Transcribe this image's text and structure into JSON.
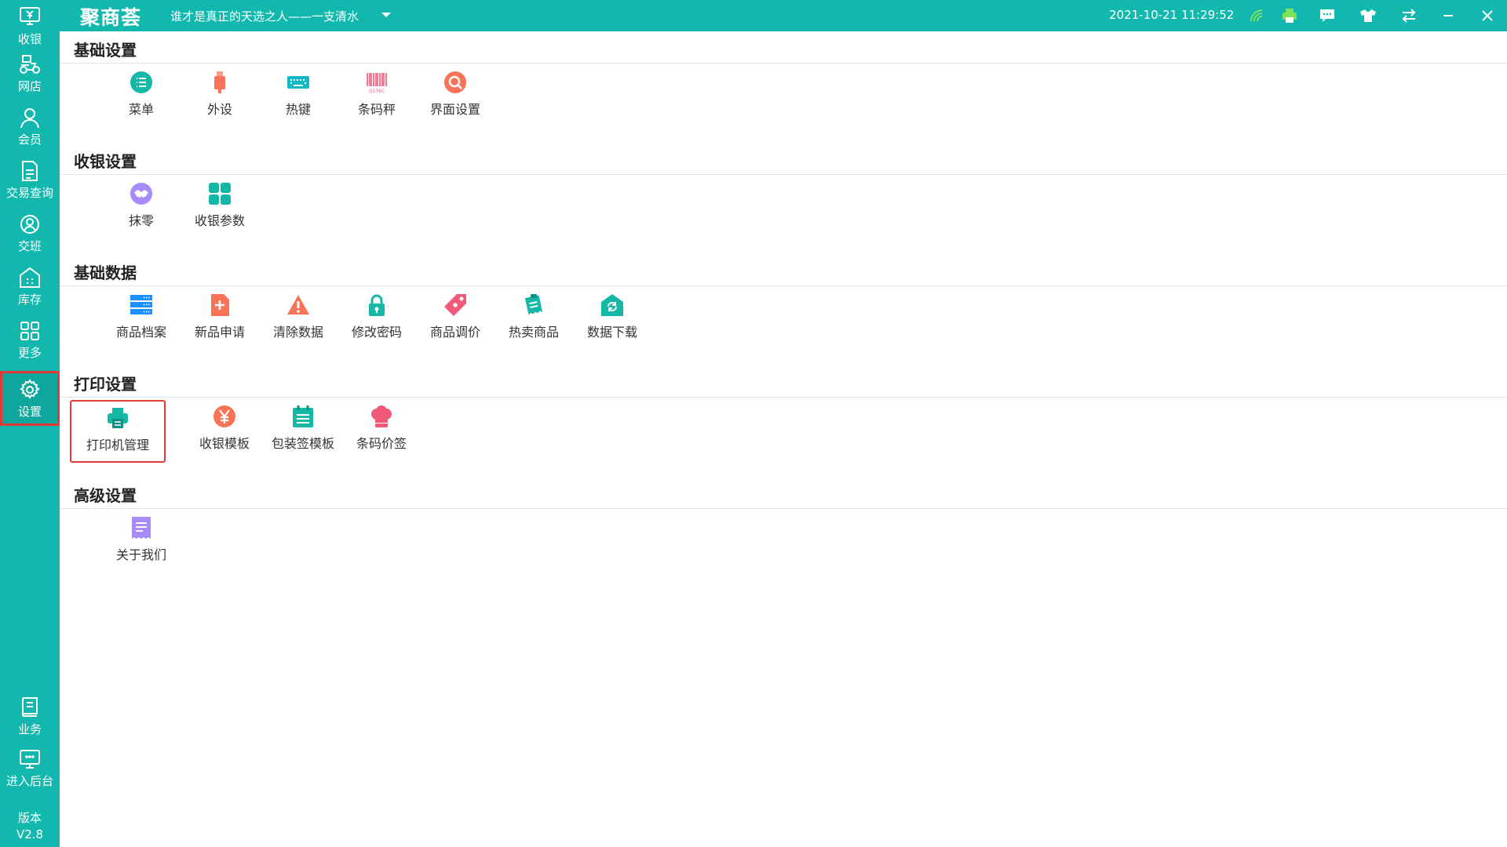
{
  "app": {
    "logo_text": "聚商荟",
    "slogan": "谁才是真正的天选之人——一支清水",
    "datetime": "2021-10-21 11:29:52",
    "brand_color": "#12b8ad",
    "highlight_color": "#e53935"
  },
  "sidebar": {
    "items": [
      {
        "label": "收银",
        "icon": "cashier-icon"
      },
      {
        "label": "网店",
        "icon": "delivery-icon"
      },
      {
        "label": "会员",
        "icon": "user-icon"
      },
      {
        "label": "交易查询",
        "icon": "document-icon"
      },
      {
        "label": "交班",
        "icon": "shift-icon"
      },
      {
        "label": "库存",
        "icon": "warehouse-icon"
      },
      {
        "label": "更多",
        "icon": "grid-icon"
      },
      {
        "label": "设置",
        "icon": "gear-icon",
        "active": true
      },
      {
        "label": "业务",
        "icon": "book-icon"
      },
      {
        "label": "进入后台",
        "icon": "monitor-icon"
      }
    ],
    "version_label": "版本",
    "version_value": "V2.8"
  },
  "sections": [
    {
      "title": "基础设置",
      "items": [
        {
          "label": "菜单",
          "icon": "menu-list-icon",
          "color": "#14b8a6"
        },
        {
          "label": "外设",
          "icon": "usb-device-icon",
          "color": "#f97356"
        },
        {
          "label": "热键",
          "icon": "keyboard-icon",
          "color": "#14b8c4"
        },
        {
          "label": "条码秤",
          "icon": "barcode-icon",
          "color": "#f05a78"
        },
        {
          "label": "界面设置",
          "icon": "search-circle-icon",
          "color": "#f97356"
        }
      ]
    },
    {
      "title": "收银设置",
      "items": [
        {
          "label": "抹零",
          "icon": "handshake-icon",
          "color": "#a78bfa"
        },
        {
          "label": "收银参数",
          "icon": "grid-icon",
          "color": "#14b8a6"
        }
      ]
    },
    {
      "title": "基础数据",
      "items": [
        {
          "label": "商品档案",
          "icon": "server-icon",
          "color": "#1e90ff"
        },
        {
          "label": "新品申请",
          "icon": "new-file-icon",
          "color": "#f97356"
        },
        {
          "label": "清除数据",
          "icon": "warning-icon",
          "color": "#f97356"
        },
        {
          "label": "修改密码",
          "icon": "lock-icon",
          "color": "#14b8a6"
        },
        {
          "label": "商品调价",
          "icon": "price-tag-icon",
          "color": "#f05a78"
        },
        {
          "label": "热卖商品",
          "icon": "clipboard-icon",
          "color": "#14b8a6"
        },
        {
          "label": "数据下载",
          "icon": "home-refresh-icon",
          "color": "#14b8a6"
        }
      ]
    },
    {
      "title": "打印设置",
      "items": [
        {
          "label": "打印机管理",
          "icon": "printer-icon",
          "color": "#14b8a6",
          "selected": true
        },
        {
          "label": "收银模板",
          "icon": "yen-circle-icon",
          "color": "#f97356"
        },
        {
          "label": "包装签模板",
          "icon": "calendar-icon",
          "color": "#14b8a6"
        },
        {
          "label": "条码价签",
          "icon": "chef-hat-icon",
          "color": "#f05a78"
        }
      ]
    },
    {
      "title": "高级设置",
      "items": [
        {
          "label": "关于我们",
          "icon": "receipt-icon",
          "color": "#a78bfa"
        }
      ]
    }
  ]
}
